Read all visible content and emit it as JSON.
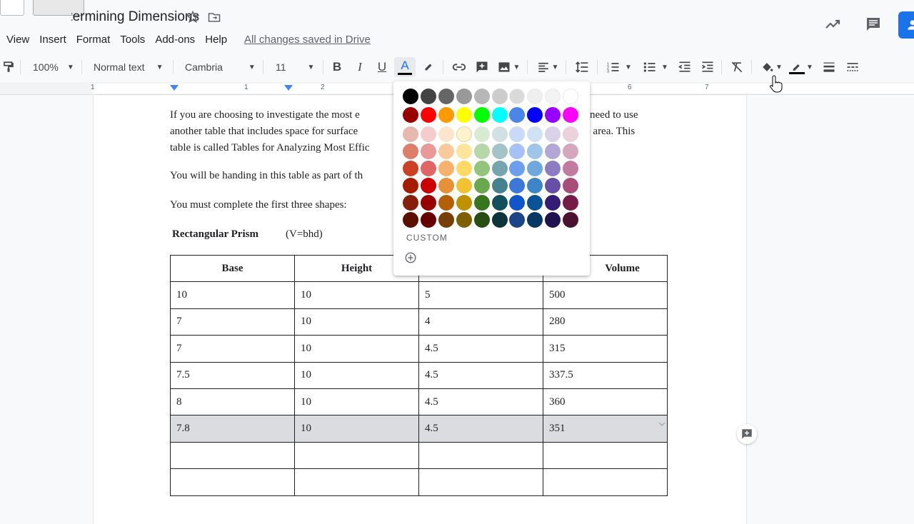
{
  "header": {
    "title": "Determining Dimensions",
    "menu": [
      "View",
      "Insert",
      "Format",
      "Tools",
      "Add-ons",
      "Help"
    ],
    "saved_status": "All changes saved in Drive"
  },
  "toolbar": {
    "zoom": "100%",
    "style": "Normal text",
    "font": "Cambria",
    "size": "11"
  },
  "ruler": {
    "labels": [
      "1",
      "1",
      "2",
      "6",
      "7"
    ]
  },
  "document": {
    "para1_line1": " If you are choosing to investigate the most e",
    "para1_line1_end": "need to use",
    "para1_line2": "another table that includes space for surface",
    "para1_line2_end": "e area. This",
    "para1_line3": "table is called Tables for Analyzing Most Effic",
    "para2": " You will be handing in this table as part of th",
    "para3": "You must complete the first three shapes:",
    "heading": "Rectangular Prism",
    "formula": "(V=bhd)"
  },
  "table": {
    "headers": [
      "Base",
      "Height",
      "",
      "Volume"
    ],
    "header_volume_visible": "Volume",
    "rows": [
      [
        "10",
        "10",
        "5",
        "500"
      ],
      [
        "7",
        "10",
        "4",
        "280"
      ],
      [
        "7",
        "10",
        "4.5",
        "315"
      ],
      [
        "7.5",
        "10",
        "4.5",
        "337.5"
      ],
      [
        "8",
        "10",
        "4.5",
        "360"
      ],
      [
        "7.8",
        "10",
        "4.5",
        "351"
      ],
      [
        "",
        "",
        "",
        ""
      ],
      [
        "",
        "",
        "",
        ""
      ]
    ]
  },
  "palette": {
    "custom_label": "CUSTOM",
    "rows": [
      [
        "#000000",
        "#434343",
        "#666666",
        "#999999",
        "#b7b7b7",
        "#cccccc",
        "#d9d9d9",
        "#efefef",
        "#f3f3f3",
        "#ffffff"
      ],
      [
        "#980000",
        "#ff0000",
        "#ff9900",
        "#ffff00",
        "#00ff00",
        "#00ffff",
        "#4a86e8",
        "#0000ff",
        "#9900ff",
        "#ff00ff"
      ],
      [
        "#e6b8af",
        "#f4cccc",
        "#fce5cd",
        "#fff2cc",
        "#d9ead3",
        "#d0e0e3",
        "#c9daf8",
        "#cfe2f3",
        "#d9d2e9",
        "#ead1dc"
      ],
      [
        "#dd7e6b",
        "#ea9999",
        "#f9cb9c",
        "#ffe599",
        "#b6d7a8",
        "#a2c4c9",
        "#a4c2f4",
        "#9fc5e8",
        "#b4a7d6",
        "#d5a6bd"
      ],
      [
        "#cc4125",
        "#e06666",
        "#f6b26b",
        "#ffd966",
        "#93c47d",
        "#76a5af",
        "#6d9eeb",
        "#6fa8dc",
        "#8e7cc3",
        "#c27ba0"
      ],
      [
        "#a61c00",
        "#cc0000",
        "#e69138",
        "#f1c232",
        "#6aa84f",
        "#45818e",
        "#3c78d8",
        "#3d85c6",
        "#674ea7",
        "#a64d79"
      ],
      [
        "#85200c",
        "#990000",
        "#b45f06",
        "#bf9000",
        "#38761d",
        "#134f5c",
        "#1155cc",
        "#0b5394",
        "#351c75",
        "#741b47"
      ],
      [
        "#5b0f00",
        "#660000",
        "#783f04",
        "#7f6000",
        "#274e13",
        "#0c343d",
        "#1c4587",
        "#073763",
        "#20124d",
        "#4c1130"
      ]
    ]
  }
}
